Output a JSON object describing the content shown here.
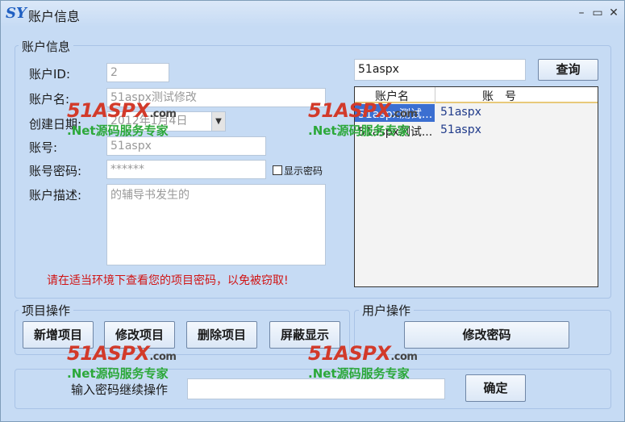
{
  "window": {
    "title": "账户信息",
    "logo_text": "SY",
    "minimize_icon": "minimize-icon",
    "maximize_icon": "maximize-icon",
    "close_icon": "close-icon"
  },
  "account": {
    "group_title": "账户信息",
    "id_label": "账户ID:",
    "id_value": "2",
    "name_label": "账户名:",
    "name_value": "51aspx测试修改",
    "created_label": "创建日期:",
    "created_value": "2012年1月4日",
    "number_label": "账号:",
    "number_value": "51aspx",
    "password_label": "账号密码:",
    "password_value": "******",
    "show_password_label": "显示密码",
    "desc_label": "账户描述:",
    "desc_value": "的辅导书发生的",
    "warning": "请在适当环境下查看您的项目密码，以免被窃取!"
  },
  "search": {
    "value": "51aspx",
    "button": "查询"
  },
  "grid": {
    "headers": [
      "账户名",
      "账　号"
    ],
    "rows": [
      {
        "name": "51aspx测试...",
        "account": "51aspx",
        "selected": true
      },
      {
        "name": "51aspx测试...",
        "account": "51aspx",
        "selected": false
      }
    ]
  },
  "project_ops": {
    "title": "项目操作",
    "buttons": [
      "新增项目",
      "修改项目",
      "删除项目",
      "屏蔽显示"
    ]
  },
  "user_ops": {
    "title": "用户操作",
    "button": "修改密码"
  },
  "confirm": {
    "label": "输入密码继续操作",
    "value": "",
    "button": "确定"
  },
  "watermark": {
    "logo": "51ASPX",
    "domain": ".com",
    "slogan": ".Net源码服务专家"
  },
  "colors": {
    "accent": "#1f5fc2",
    "warning": "#d11414",
    "selection": "#3b6fd1",
    "watermark_red": "#d23a2a",
    "watermark_green": "#2ca83a"
  }
}
